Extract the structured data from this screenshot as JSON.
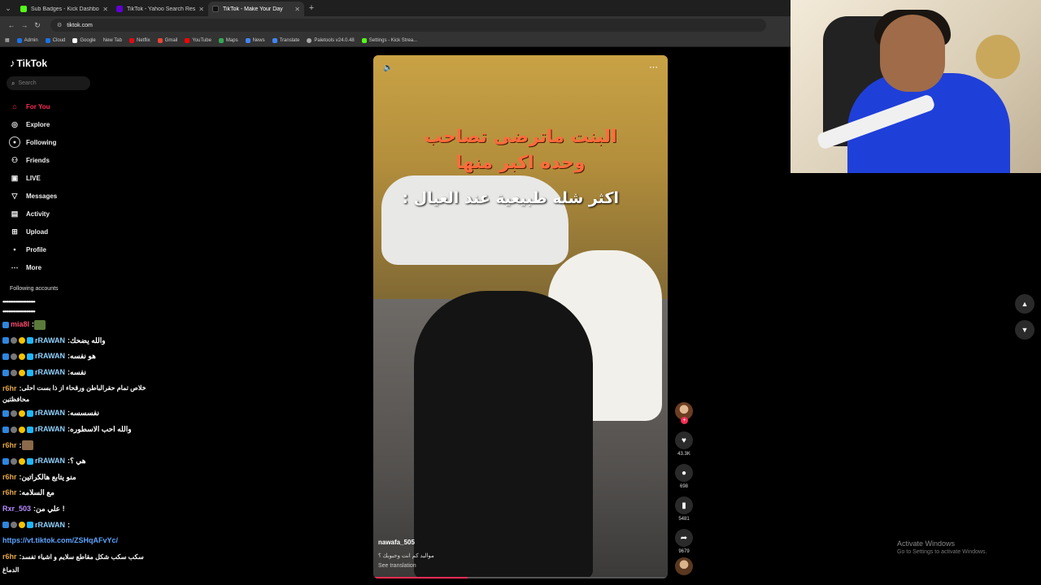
{
  "browser": {
    "tabs": [
      {
        "title": "Sub Badges - Kick Dashboard",
        "color": "#53fc18"
      },
      {
        "title": "TikTok - Yahoo Search Results",
        "color": "#6001d2"
      },
      {
        "title": "TikTok - Make Your Day",
        "color": "#111111"
      }
    ],
    "url": "tiktok.com",
    "bookmarks": [
      {
        "label": "Admin",
        "color": "#1a73e8"
      },
      {
        "label": "Cloud",
        "color": "#1a73e8"
      },
      {
        "label": "Google",
        "color": "#ffffff"
      },
      {
        "label": "New Tab",
        "color": "#444444"
      },
      {
        "label": "Netflix",
        "color": "#e50914"
      },
      {
        "label": "Gmail",
        "color": "#ea4335"
      },
      {
        "label": "YouTube",
        "color": "#ff0000"
      },
      {
        "label": "Maps",
        "color": "#34a853"
      },
      {
        "label": "News",
        "color": "#4285f4"
      },
      {
        "label": "Translate",
        "color": "#4285f4"
      },
      {
        "label": "Paletools v24.0.48",
        "color": "#aaaaaa"
      },
      {
        "label": "Settings - Kick Strea...",
        "color": "#53fc18"
      }
    ]
  },
  "sidebar": {
    "logo": "TikTok",
    "search_placeholder": "Search",
    "menu": [
      {
        "label": "For You",
        "icon": "home-icon",
        "glyph": "⌂",
        "active": true
      },
      {
        "label": "Explore",
        "icon": "compass-icon",
        "glyph": "◎"
      },
      {
        "label": "Following",
        "icon": "following-icon",
        "glyph": "●"
      },
      {
        "label": "Friends",
        "icon": "friends-icon",
        "glyph": "⚇"
      },
      {
        "label": "LIVE",
        "icon": "live-icon",
        "glyph": "▣"
      },
      {
        "label": "Messages",
        "icon": "messages-icon",
        "glyph": "▽"
      },
      {
        "label": "Activity",
        "icon": "activity-icon",
        "glyph": "▤"
      },
      {
        "label": "Upload",
        "icon": "upload-icon",
        "glyph": "⊞"
      },
      {
        "label": "Profile",
        "icon": "profile-icon",
        "glyph": "•"
      },
      {
        "label": "More",
        "icon": "more-icon",
        "glyph": "⋯"
      }
    ],
    "following_header": "Following accounts"
  },
  "chat": {
    "dots_line": "••••••••••••••••••••••",
    "lines": [
      {
        "user": "mia8l",
        "cls": "ug",
        "msg": ""
      },
      {
        "user": "rRAWAN",
        "cls": "ur",
        "msg": "والله يضحك"
      },
      {
        "user": "rRAWAN",
        "cls": "ur",
        "msg": "هو نفسه"
      },
      {
        "user": "rRAWAN",
        "cls": "ur",
        "msg": "نفسه"
      },
      {
        "user": "r6hr",
        "cls": "uo",
        "msg": "خلاص تمام حقرالباطن ورقحاء از ذا بست احلى"
      },
      {
        "user": "",
        "cls": "",
        "msg": "محافظتين"
      },
      {
        "user": "rRAWAN",
        "cls": "ur",
        "msg": "نفسسسه"
      },
      {
        "user": "rRAWAN",
        "cls": "ur",
        "msg": "والله احب الاسطوره"
      },
      {
        "user": "r6hr",
        "cls": "uo",
        "msg": ""
      },
      {
        "user": "rRAWAN",
        "cls": "ur",
        "msg": "هي ؟"
      },
      {
        "user": "r6hr",
        "cls": "uo",
        "msg": "منو يتابع هالكراتين"
      },
      {
        "user": "r6hr",
        "cls": "uo",
        "msg": "مع السلامه"
      },
      {
        "user": "Rxr_503",
        "cls": "up",
        "msg": "علي من !"
      },
      {
        "user": "rRAWAN",
        "cls": "ur",
        "msg": ""
      },
      {
        "user": "",
        "cls": "link",
        "msg": "https://vt.tiktok.com/ZSHqAFvYc/"
      },
      {
        "user": "r6hr",
        "cls": "uo",
        "msg": "سكب سكب شكل مقاطع سلايم و اشياء تفسد"
      },
      {
        "user": "",
        "cls": "",
        "msg": "الدماغ"
      }
    ]
  },
  "video": {
    "overlay_line1": "البنت ماترضى تصاحب",
    "overlay_line2": "وحده اكبر منها",
    "overlay_line3": "اكثر شله طبيعية عند العيال :",
    "username": "nawafa_505",
    "description": "مواليد كم انت وحبوبك ؟",
    "see_translation": "See translation",
    "progress": 0.32
  },
  "rail": {
    "likes": "43.3K",
    "comments": "698",
    "saves": "5481",
    "shares": "9679"
  },
  "windows": {
    "activate_title": "Activate Windows",
    "activate_sub": "Go to Settings to activate Windows."
  }
}
